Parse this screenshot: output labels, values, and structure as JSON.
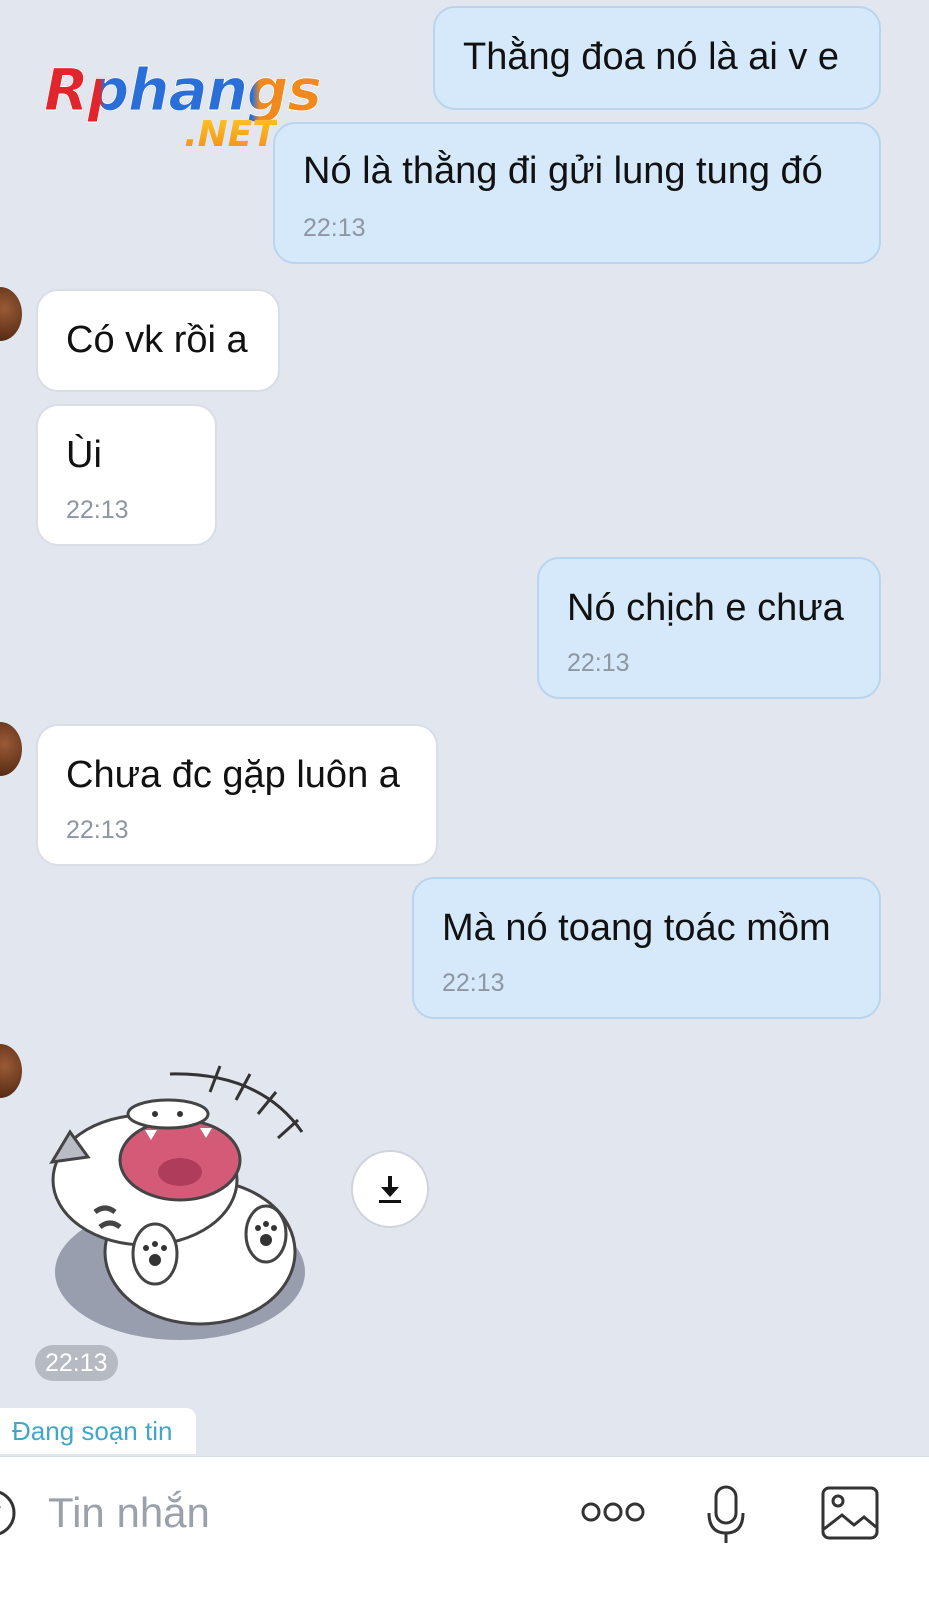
{
  "logo": {
    "main": "Rphangs",
    "sub": ".NET"
  },
  "messages": [
    {
      "text": "Thằng đoa nó là ai v e",
      "time": ""
    },
    {
      "text": "Nó là thằng đi gửi lung tung đó",
      "time": "22:13"
    },
    {
      "text": "Có vk rồi a",
      "time": ""
    },
    {
      "text": "Ùi",
      "time": "22:13"
    },
    {
      "text": "Nó chịch e chưa",
      "time": "22:13"
    },
    {
      "text": "Chưa đc gặp luôn a",
      "time": "22:13"
    },
    {
      "text": "Mà nó toang toác mồm",
      "time": "22:13"
    }
  ],
  "sticker": {
    "time": "22:13"
  },
  "typing_status": "Đang soạn tin",
  "input": {
    "placeholder": "Tin nhắn"
  },
  "icons": {
    "emoji": "emoji-icon",
    "more": "more-icon",
    "mic": "microphone-icon",
    "image": "image-icon",
    "download": "download-icon"
  },
  "colors": {
    "background": "#e2e6ee",
    "outgoing_bubble": "#d5e9fb",
    "incoming_bubble": "#ffffff",
    "typing_text": "#3fa7c9"
  }
}
